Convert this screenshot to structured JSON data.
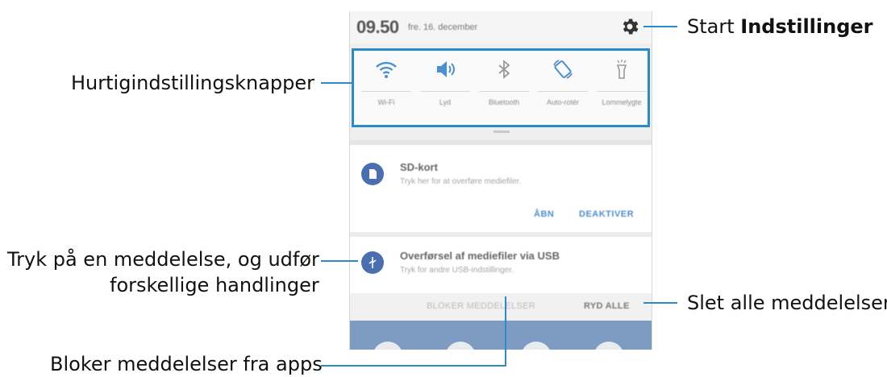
{
  "callouts": {
    "settings_prefix": "Start ",
    "settings_bold": "Indstillinger",
    "quick_settings": "Hurtigindstillingsknapper",
    "notification_line1": "Tryk på en meddelelse, og udfør",
    "notification_line2": "forskellige handlinger",
    "clear_all": "Slet alle meddelelser",
    "block": "Bloker meddelelser fra apps"
  },
  "status": {
    "time": "09.50",
    "date": "fre. 16. december"
  },
  "quick_settings": [
    {
      "label": "Wi-Fi",
      "icon": "wifi-icon"
    },
    {
      "label": "Lyd",
      "icon": "sound-icon"
    },
    {
      "label": "Bluetooth",
      "icon": "bluetooth-icon"
    },
    {
      "label": "Auto-rotér",
      "icon": "auto-rotate-icon"
    },
    {
      "label": "Lommelygte",
      "icon": "flashlight-icon"
    }
  ],
  "notifications": [
    {
      "title": "SD-kort",
      "subtitle": "Tryk her for at overføre mediefiler.",
      "icon": "sd-card-icon",
      "actions": [
        "ÅBN",
        "DEAKTIVER"
      ]
    },
    {
      "title": "Overførsel af mediefiler via USB",
      "subtitle": "Tryk for andre USB-indstillinger.",
      "icon": "usb-icon"
    }
  ],
  "bottom_bar": {
    "block_label": "BLOKER MEDDELELSER",
    "clear_label": "RYD ALLE"
  },
  "colors": {
    "accent": "#2a8bc9",
    "icon_active": "#4a8fd0",
    "app_icon": "#4a6fb0"
  }
}
